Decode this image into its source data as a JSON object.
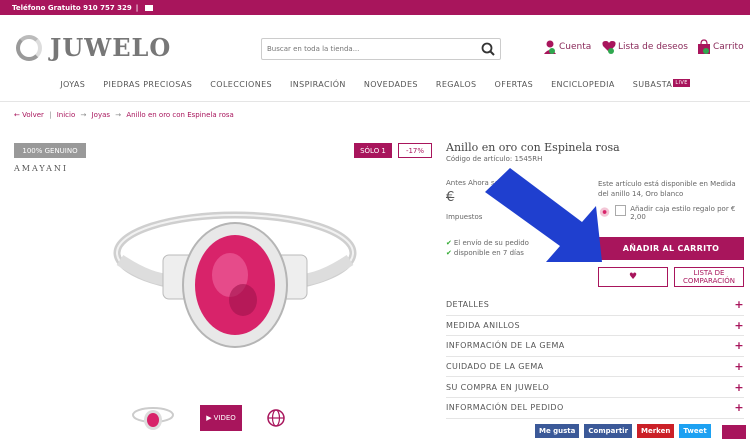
{
  "topbar": {
    "phone_text": "Teléfono Gratuito 910 757 329",
    "separator": "|"
  },
  "header": {
    "logo_text": "JUWELO",
    "search_placeholder": "Buscar en toda la tienda...",
    "account_label": "Cuenta",
    "wishlist_label": "Lista de deseos",
    "wishlist_count": "0",
    "cart_label": "Carrito",
    "cart_count": "0"
  },
  "nav": {
    "items": [
      "JOYAS",
      "PIEDRAS PRECIOSAS",
      "COLECCIONES",
      "INSPIRACIÓN",
      "NOVEDADES",
      "REGALOS",
      "OFERTAS",
      "ENCICLOPEDIA",
      "SUBASTA"
    ],
    "live_badge": "LIVE"
  },
  "breadcrumb": {
    "back": "← Volver",
    "sep": "|",
    "home": "Inicio",
    "arrow": "→",
    "joyas": "Joyas",
    "current": "Anillo en oro con Espinela rosa"
  },
  "product": {
    "genuine_badge": "100% GENUINO",
    "brand": "AMAYANI",
    "solo_badge": "SÓLO 1",
    "discount_badge": "-17%",
    "title": "Anillo en oro con Espinela rosa",
    "code_text": "Código de artículo: 1545RH",
    "price_labels": "Antes          Ahora solo",
    "price_old": "€",
    "tax_text": "Impuestos",
    "shipping_line1": "El envío de su pedido",
    "shipping_line2": "disponible en 7 días",
    "availability": "Este artículo está disponible en Medida del anillo 14, Oro blanco",
    "gift_box": "Añadir caja estilo regalo por € 2,00",
    "add_to_cart": "AÑADIR AL CARRITO",
    "wishlist_icon": "heart-icon",
    "compare_label": "LISTA DE COMPARACIÓN",
    "video_label": "VIDEO"
  },
  "accordion": {
    "items": [
      "DETALLES",
      "MEDIDA ANILLOS",
      "INFORMACIÓN DE LA GEMA",
      "CUIDADO DE LA GEMA",
      "SU COMPRA EN JUWELO",
      "INFORMACIÓN DEL PEDIDO"
    ],
    "plus": "+"
  },
  "social": {
    "facebook": "Me gusta",
    "share": "Compartir",
    "pinterest": "Merken",
    "tweet": "Tweet"
  },
  "colors": {
    "brand": "#a8155c",
    "arrow": "#1f3fcf",
    "gem": "#d8236a",
    "facebook": "#3b5998",
    "share": "#3b5998",
    "pinterest": "#cb2027",
    "twitter": "#1da1f2"
  }
}
